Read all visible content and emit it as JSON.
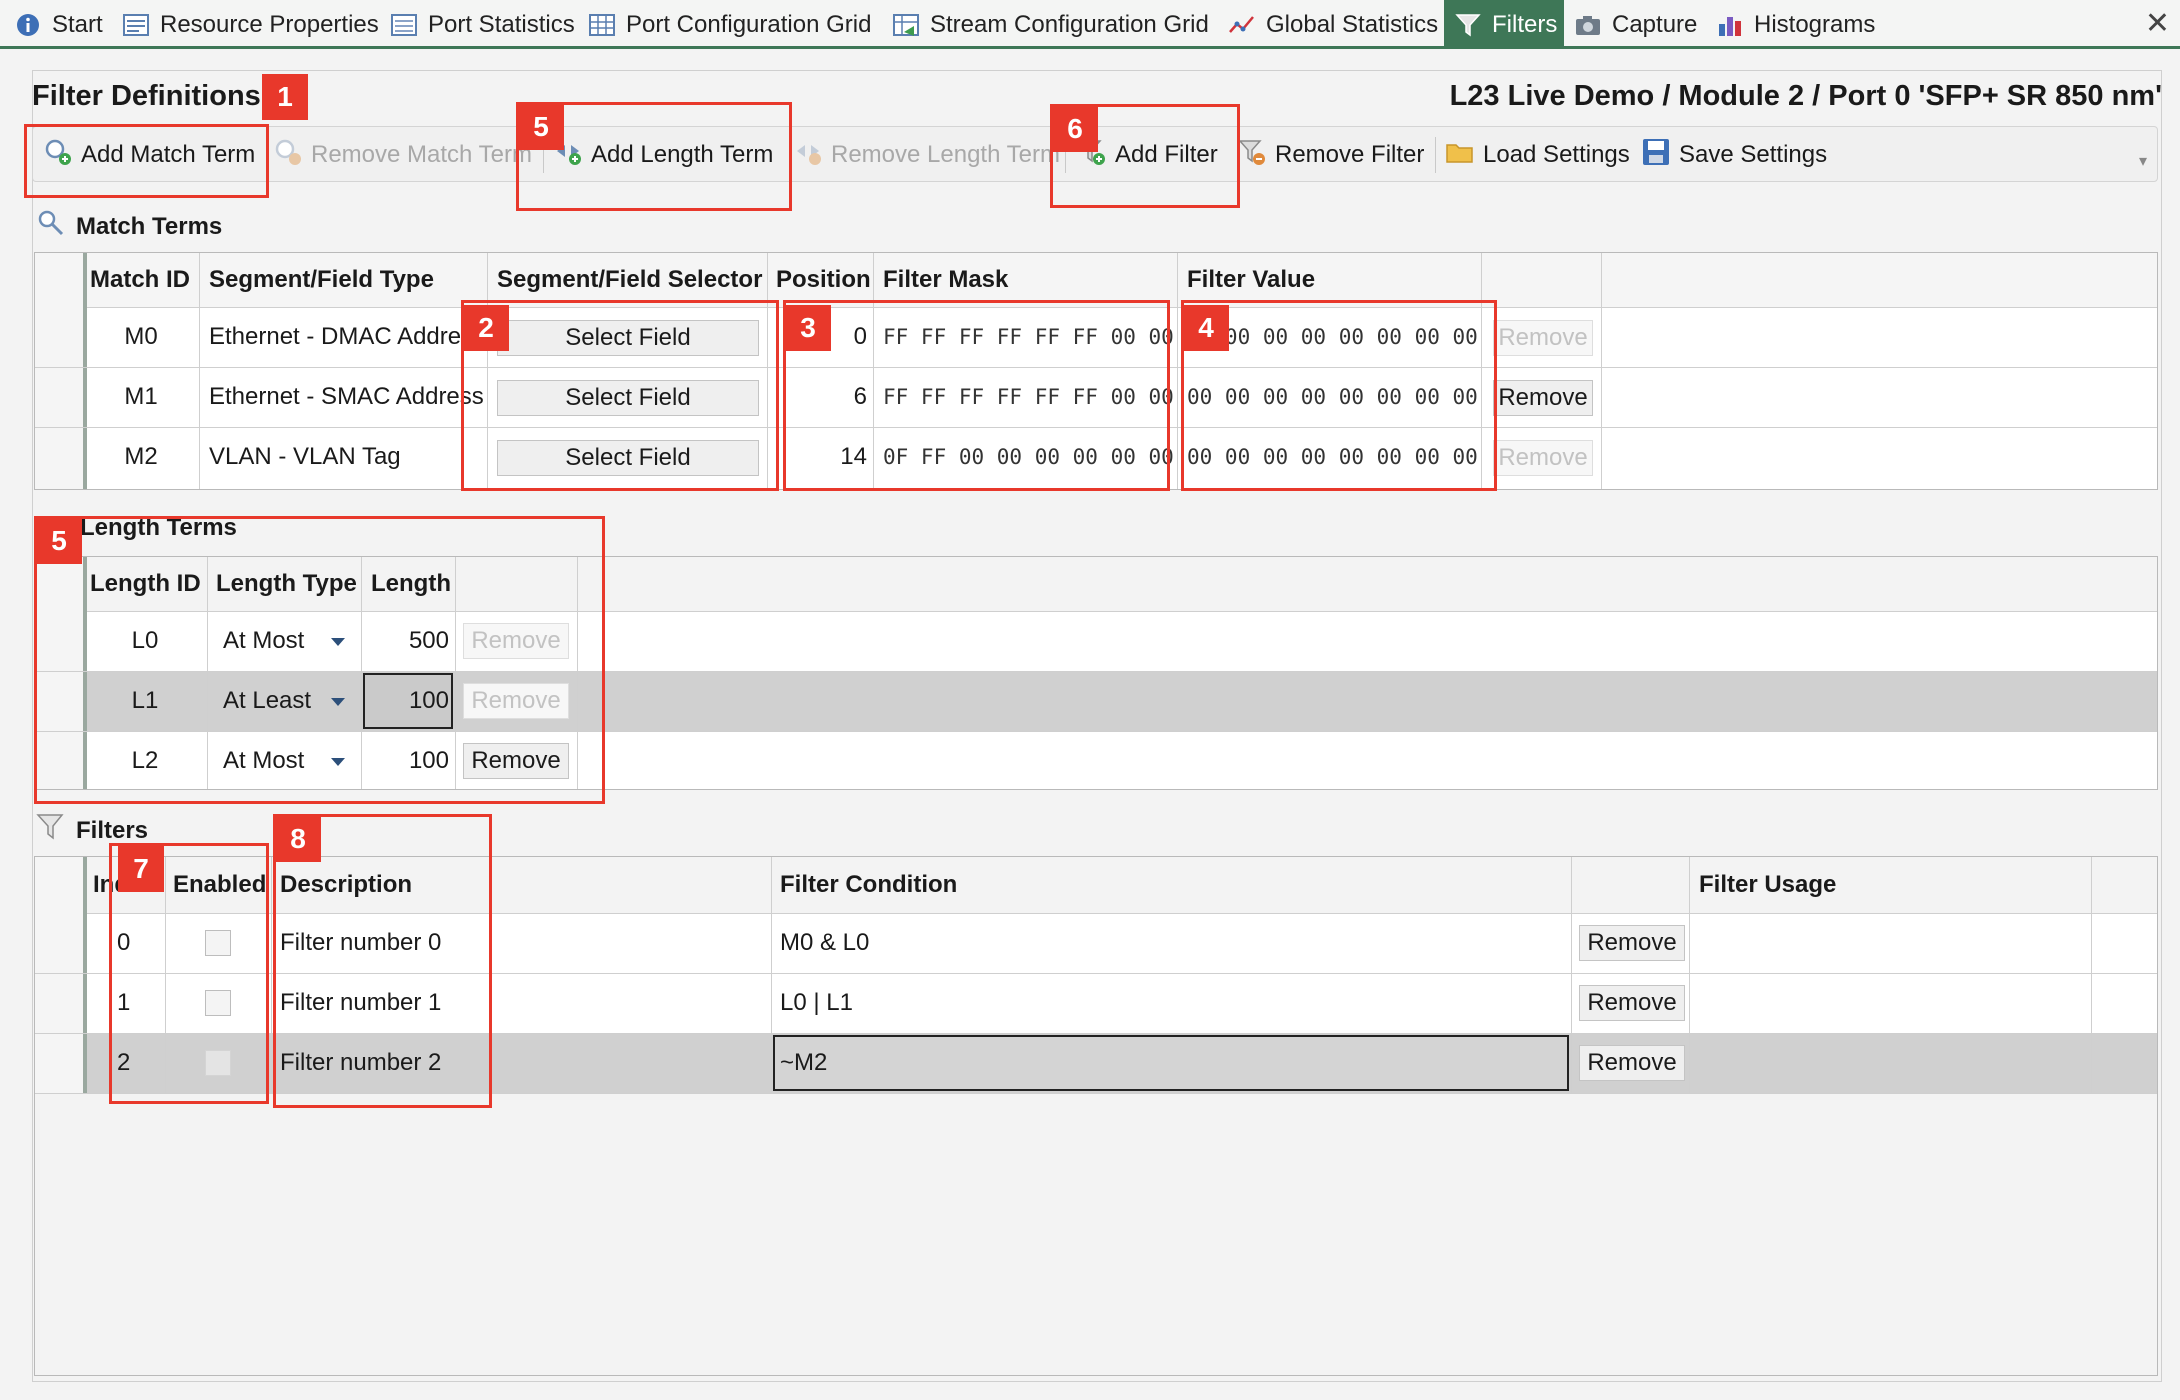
{
  "tabs": [
    {
      "label": "Start",
      "icon": "info-icon"
    },
    {
      "label": "Resource Properties",
      "icon": "properties-icon"
    },
    {
      "label": "Port Statistics",
      "icon": "statistics-icon"
    },
    {
      "label": "Port Configuration Grid",
      "icon": "grid-icon"
    },
    {
      "label": "Stream Configuration Grid",
      "icon": "stream-grid-icon"
    },
    {
      "label": "Global Statistics",
      "icon": "line-chart-icon"
    },
    {
      "label": "Filters",
      "icon": "funnel-icon",
      "active": true
    },
    {
      "label": "Capture",
      "icon": "camera-icon"
    },
    {
      "label": "Histograms",
      "icon": "bar-chart-icon"
    }
  ],
  "header": {
    "title": "Filter Definitions",
    "port_path": "L23 Live Demo / Module 2 / Port 0 'SFP+ SR 850 nm'"
  },
  "toolbar": {
    "add_match_term": "Add Match Term",
    "remove_match_term": "Remove Match Term",
    "add_length_term": "Add Length Term",
    "remove_length_term": "Remove Length Term",
    "add_filter": "Add Filter",
    "remove_filter": "Remove Filter",
    "load_settings": "Load Settings",
    "save_settings": "Save Settings"
  },
  "match_terms": {
    "title": "Match Terms",
    "columns": [
      "Match ID",
      "Segment/Field Type",
      "Segment/Field Selector",
      "Position",
      "Filter Mask",
      "Filter Value"
    ],
    "select_label": "Select Field",
    "remove_label": "Remove",
    "rows": [
      {
        "id": "M0",
        "type": "Ethernet - DMAC Address",
        "position": "0",
        "mask": "FF FF FF FF FF FF 00 00",
        "value": "00 00 00 00 00 00 00 00",
        "remove_enabled": false
      },
      {
        "id": "M1",
        "type": "Ethernet - SMAC Address",
        "position": "6",
        "mask": "FF FF FF FF FF FF 00 00",
        "value": "00 00 00 00 00 00 00 00",
        "remove_enabled": true
      },
      {
        "id": "M2",
        "type": "VLAN - VLAN Tag",
        "position": "14",
        "mask": "0F FF 00 00 00 00 00 00",
        "value": "00 00 00 00 00 00 00 00",
        "remove_enabled": false
      }
    ]
  },
  "length_terms": {
    "title": "Length Terms",
    "columns": [
      "Length ID",
      "Length Type",
      "Length"
    ],
    "remove_label": "Remove",
    "rows": [
      {
        "id": "L0",
        "type": "At Most",
        "length": "500",
        "remove_enabled": false,
        "selected": false
      },
      {
        "id": "L1",
        "type": "At Least",
        "length": "100",
        "remove_enabled": false,
        "selected": true
      },
      {
        "id": "L2",
        "type": "At Most",
        "length": "100",
        "remove_enabled": true,
        "selected": false
      }
    ]
  },
  "filters": {
    "title": "Filters",
    "columns": [
      "Index",
      "Enabled",
      "Description",
      "Filter Condition",
      "Filter Usage"
    ],
    "remove_label": "Remove",
    "rows": [
      {
        "index": "0",
        "enabled": false,
        "description": "Filter number 0",
        "condition": "M0 & L0",
        "selected": false
      },
      {
        "index": "1",
        "enabled": false,
        "description": "Filter number 1",
        "condition": "L0  |  L1",
        "selected": false
      },
      {
        "index": "2",
        "enabled": false,
        "description": "Filter number 2",
        "condition": "~M2",
        "selected": true
      }
    ]
  },
  "annotations": [
    "1",
    "2",
    "3",
    "4",
    "5",
    "5",
    "6",
    "7",
    "8"
  ],
  "colors": {
    "accent": "#3e7757",
    "annotation": "#e8382b",
    "selected_row": "#d0d0d0"
  }
}
